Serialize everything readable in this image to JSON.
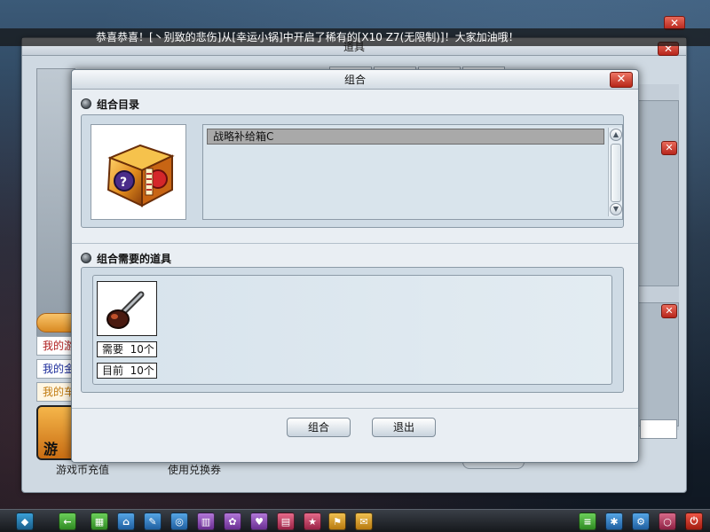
{
  "banner": {
    "text": "恭喜恭喜！[丶别致的悲伤]从[幸运小锅]中开启了稀有的[X10 Z7(无限制)]！大家加油哦！"
  },
  "background_window": {
    "title": "道具",
    "close_label": "✕",
    "menu": [
      "我的游",
      "我的金",
      "我的车"
    ],
    "game_button_label": "游",
    "bottom_left_label": "游戏币充值",
    "bottom_mid_label": "使用兑换券"
  },
  "dialog": {
    "title": "组合",
    "close_label": "✕",
    "catalog": {
      "heading": "组合目录",
      "items": [
        "战略补给箱C"
      ],
      "scroll_up": "▲",
      "scroll_down": "▼"
    },
    "required": {
      "heading": "组合需要的道具",
      "need_label": "需要",
      "need_value": "10个",
      "current_label": "目前",
      "current_value": "10个"
    },
    "buttons": {
      "combine": "组合",
      "exit": "退出"
    }
  },
  "colors": {
    "dialog_bg": "#e9eef3",
    "panel_bg": "#cfdbe5",
    "selected_row": "#a9a9a9",
    "close_red": "#b72718"
  },
  "taskbar": {
    "icons": [
      "windows-logo-icon",
      "back-arrow-icon",
      "shop-cart-icon",
      "home-icon",
      "wrench-icon",
      "item-box-icon",
      "calendar-icon",
      "team-icon",
      "gift-icon",
      "book-icon",
      "stars-icon",
      "flag-icon",
      "message-icon",
      "notebook-icon",
      "puzzle-icon",
      "settings-gear-icon",
      "search-icon",
      "power-icon"
    ]
  }
}
